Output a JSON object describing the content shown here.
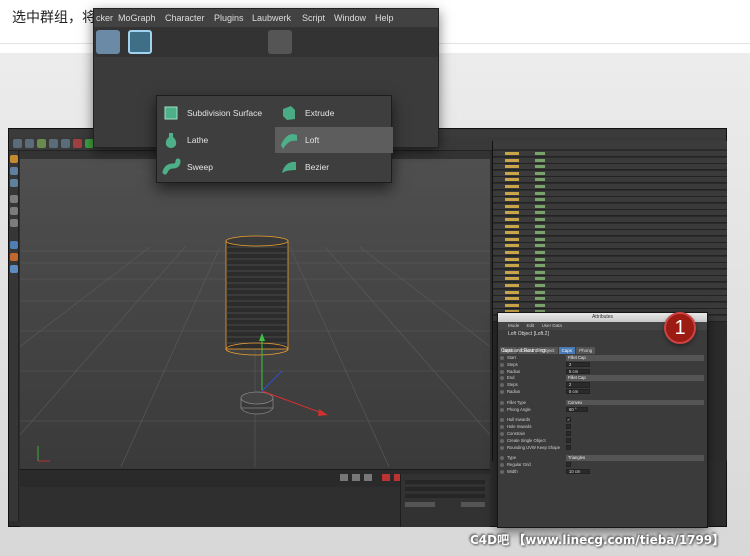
{
  "caption": "选中群组，将群组中的内容拆分出来",
  "menubar": {
    "items": [
      "cker",
      "MoGraph",
      "Character",
      "Plugins",
      "Laubwerk",
      "Script",
      "Window",
      "Help"
    ]
  },
  "dropdown": {
    "items": [
      {
        "label": "Subdivision Surface",
        "icon": "subdivision-surface-icon",
        "selected": false
      },
      {
        "label": "Extrude",
        "icon": "extrude-icon",
        "selected": false
      },
      {
        "label": "Lathe",
        "icon": "lathe-icon",
        "selected": false
      },
      {
        "label": "Loft",
        "icon": "loft-icon",
        "selected": true
      },
      {
        "label": "Sweep",
        "icon": "sweep-icon",
        "selected": false
      },
      {
        "label": "Bezier",
        "icon": "bezier-icon",
        "selected": false
      }
    ]
  },
  "attributes": {
    "window_title": "Attributes",
    "menu": [
      "Mode",
      "Edit",
      "User Data"
    ],
    "object_title": "Loft Object [Loft.2]",
    "tabs": [
      {
        "label": "Basic",
        "active": false
      },
      {
        "label": "Coord.",
        "active": false
      },
      {
        "label": "Object",
        "active": false
      },
      {
        "label": "Caps",
        "active": true
      },
      {
        "label": "Phong",
        "active": false
      }
    ],
    "section": "Caps and Rounding",
    "rows": [
      {
        "label": "Start",
        "type": "dropdown",
        "value": "Fillet Cap"
      },
      {
        "label": "Steps",
        "type": "value",
        "value": "2"
      },
      {
        "label": "Radius",
        "type": "value",
        "value": "5 cm"
      },
      {
        "label": "End",
        "type": "dropdown",
        "value": "Fillet Cap"
      },
      {
        "label": "Steps",
        "type": "value",
        "value": "2"
      },
      {
        "label": "Radius",
        "type": "value",
        "value": "5 cm"
      },
      {
        "label": "",
        "type": "spacer",
        "value": ""
      },
      {
        "label": "Fillet Type",
        "type": "dropdown",
        "value": "Convex"
      },
      {
        "label": "Phong Angle",
        "type": "value",
        "value": "60 °"
      },
      {
        "label": "",
        "type": "spacer",
        "value": ""
      },
      {
        "label": "Hull Inwards",
        "type": "check",
        "value": "✓"
      },
      {
        "label": "Hole Inwards",
        "type": "check",
        "value": ""
      },
      {
        "label": "Constrain",
        "type": "check",
        "value": ""
      },
      {
        "label": "Create Single Object",
        "type": "check",
        "value": ""
      },
      {
        "label": "Rounding UVW Keep Shape",
        "type": "check",
        "value": ""
      },
      {
        "label": "",
        "type": "spacer",
        "value": ""
      },
      {
        "label": "Type",
        "type": "dropdown",
        "value": "Triangles"
      },
      {
        "label": "Regular Grid",
        "type": "check",
        "value": ""
      },
      {
        "label": "Width",
        "type": "value",
        "value": "10 cm"
      }
    ]
  },
  "badge_number": "1",
  "watermark": "C4D吧 【www.linecg.com/tieba/1799】",
  "colors": {
    "accent": "#4a7bb5",
    "badge": "#9c1c13",
    "selection": "#f0a030"
  }
}
